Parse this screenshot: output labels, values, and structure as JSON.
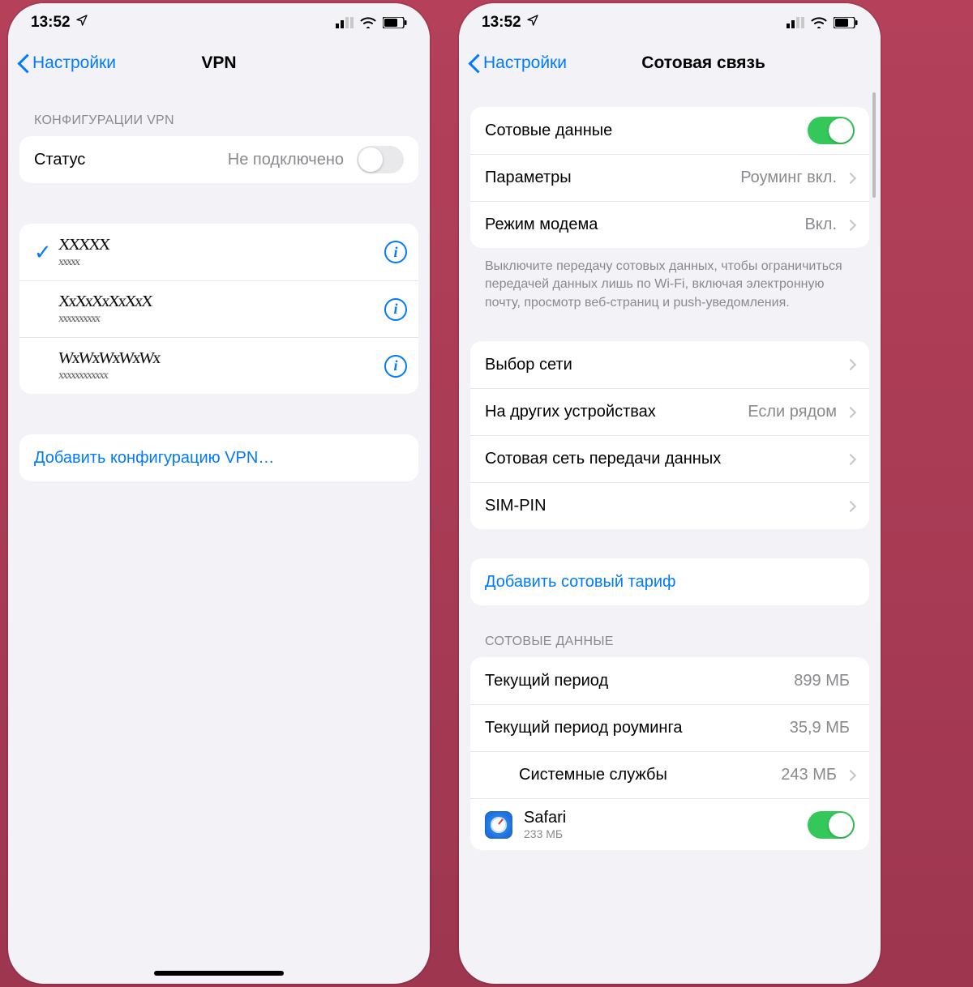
{
  "statusbar": {
    "time": "13:52"
  },
  "left": {
    "back": "Настройки",
    "title": "VPN",
    "section_configs": "КОНФИГУРАЦИИ VPN",
    "status_label": "Статус",
    "status_value": "Не подключено",
    "add_config": "Добавить конфигурацию VPN…"
  },
  "right": {
    "back": "Настройки",
    "title": "Сотовая связь",
    "rows1": {
      "cell_data": "Сотовые данные",
      "params_label": "Параметры",
      "params_value": "Роуминг вкл.",
      "modem_label": "Режим модема",
      "modem_value": "Вкл."
    },
    "footer": "Выключите передачу сотовых данных, чтобы ограничиться передачей данных лишь по Wi-Fi, включая электронную почту, просмотр веб-страниц и push-уведомления.",
    "rows2": {
      "net_select": "Выбор сети",
      "other_dev_label": "На других устройствах",
      "other_dev_value": "Если рядом",
      "data_net": "Сотовая сеть передачи данных",
      "sim_pin": "SIM-PIN"
    },
    "add_plan": "Добавить сотовый тариф",
    "section_data": "СОТОВЫЕ ДАННЫЕ",
    "usage": {
      "current_label": "Текущий период",
      "current_value": "899 МБ",
      "roaming_label": "Текущий период роуминга",
      "roaming_value": "35,9 МБ",
      "system_label": "Системные службы",
      "system_value": "243 МБ",
      "safari_label": "Safari",
      "safari_value": "233 МБ"
    }
  }
}
